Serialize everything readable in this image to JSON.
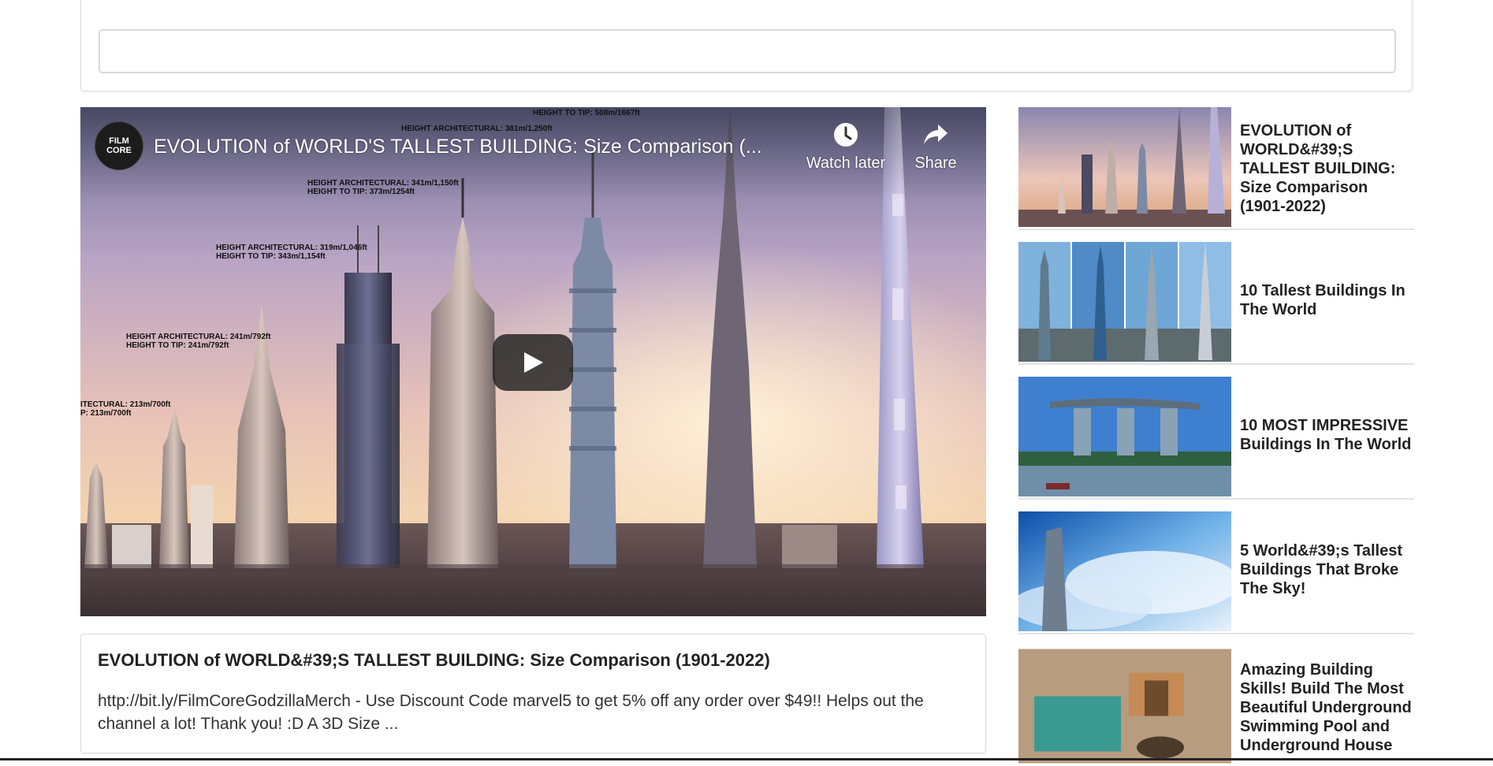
{
  "search": {
    "value": ""
  },
  "video": {
    "channel_logo": "FILM\nCORE",
    "title": "EVOLUTION of WORLD'S TALLEST BUILDING: Size Comparison (...",
    "watch_later_label": "Watch later",
    "share_label": "Share",
    "tags": [
      "HEIGHT TO TIP: 508m/1667ft",
      "HEIGHT ARCHITECTURAL: 381m/1,250ft",
      "HEIGHT ARCHITECTURAL: 341m/1,150ft",
      "HEIGHT TO TIP: 373m/1254ft",
      "HEIGHT ARCHITECTURAL: 319m/1,046ft",
      "HEIGHT TO TIP: 343m/1,154ft",
      "HEIGHT ARCHITECTURAL: 241m/792ft",
      "HEIGHT TO TIP: 241m/792ft",
      "ITECTURAL: 213m/700ft",
      "P: 213m/700ft"
    ]
  },
  "description": {
    "title": "EVOLUTION of WORLD&#39;S TALLEST BUILDING: Size Comparison (1901-2022)",
    "text": "http://bit.ly/FilmCoreGodzillaMerch - Use Discount Code marvel5 to get 5% off any order over $49!! Helps out the channel a lot! Thank you! :D A 3D Size ..."
  },
  "sidebar": {
    "items": [
      {
        "title": "EVOLUTION of WORLD&#39;S TALLEST BUILDING: Size Comparison (1901-2022)"
      },
      {
        "title": "10 Tallest Buildings In The World"
      },
      {
        "title": "10 MOST IMPRESSIVE Buildings In The World"
      },
      {
        "title": "5 World&#39;s Tallest Buildings That Broke The Sky!"
      },
      {
        "title": "Amazing Building Skills! Build The Most Beautiful Underground Swimming Pool and Underground House"
      }
    ]
  },
  "colors": {
    "border": "#dcdcdc",
    "text": "#222222",
    "sky_top": "#9a8cb8",
    "sky_glow": "#f5c9a8"
  },
  "icons": {
    "watch_later": "clock-icon",
    "share": "share-arrow-icon",
    "play": "play-icon"
  }
}
